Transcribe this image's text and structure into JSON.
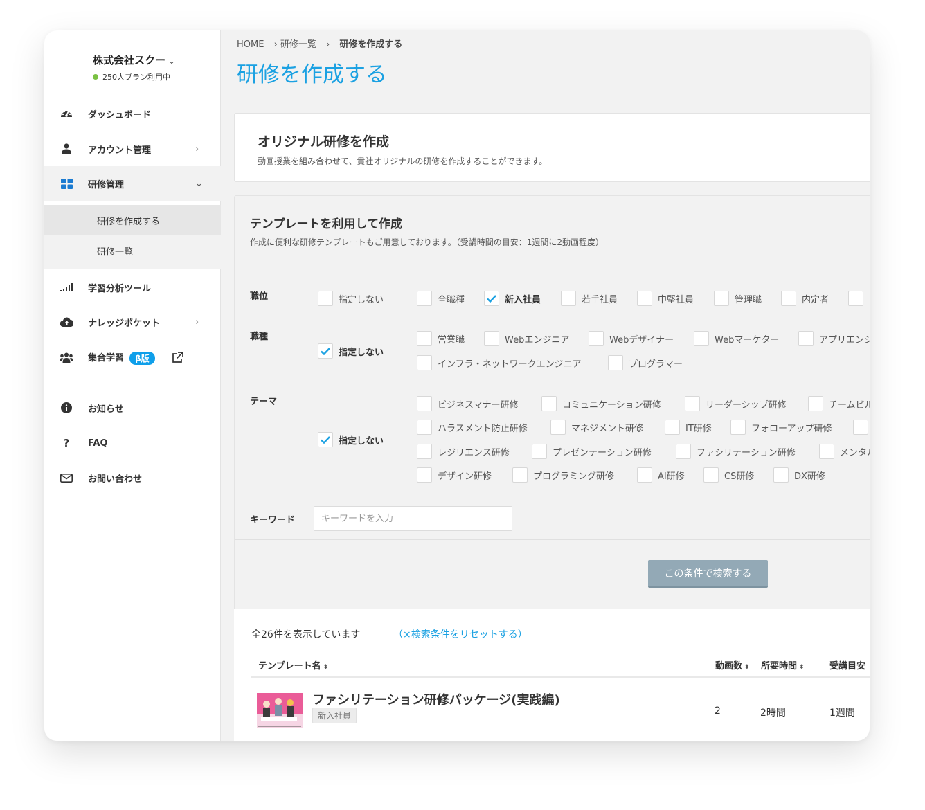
{
  "sidebar": {
    "company_name": "株式会社スクー",
    "company_chevron": "⌄",
    "plan": "250人プラン利用中",
    "items": [
      {
        "label": "ダッシュボード"
      },
      {
        "label": "アカウント管理",
        "arrow": "›"
      },
      {
        "label": "研修管理",
        "arrow": "⌄"
      },
      {
        "label": "学習分析ツール"
      },
      {
        "label": "ナレッジポケット",
        "arrow": "›"
      },
      {
        "label": "集合学習",
        "badge": "β版"
      },
      {
        "label": "お知らせ"
      },
      {
        "label": "FAQ",
        "icon_glyph": "?"
      },
      {
        "label": "お問い合わせ"
      }
    ],
    "subitems": [
      {
        "label": "研修を作成する"
      },
      {
        "label": "研修一覧"
      }
    ]
  },
  "breadcrumb": {
    "home": "HOME",
    "sep1": "› 研修一覧",
    "sep2": "›",
    "current": "研修を作成する"
  },
  "page_title": "研修を作成する",
  "original": {
    "title": "オリジナル研修を作成",
    "desc": "動画授業を組み合わせて、貴社オリジナルの研修を作成することができます。"
  },
  "template": {
    "title": "テンプレートを利用して作成",
    "desc": "作成に便利な研修テンプレートもご用意しております。（受講時間の目安：1週間に2動画程度）"
  },
  "filters": {
    "position": {
      "label": "職位",
      "none": {
        "label": "指定しない",
        "checked": false
      },
      "options": [
        {
          "label": "全職種",
          "checked": false
        },
        {
          "label": "新入社員",
          "checked": true
        },
        {
          "label": "若手社員",
          "checked": false
        },
        {
          "label": "中堅社員",
          "checked": false
        },
        {
          "label": "管理職",
          "checked": false
        },
        {
          "label": "内定者",
          "checked": false
        },
        {
          "label": "",
          "checked": false
        }
      ]
    },
    "job": {
      "label": "職種",
      "none": {
        "label": "指定しない",
        "checked": true
      },
      "options": [
        {
          "label": "営業職",
          "checked": false
        },
        {
          "label": "Webエンジニア",
          "checked": false
        },
        {
          "label": "Webデザイナー",
          "checked": false
        },
        {
          "label": "Webマーケター",
          "checked": false
        },
        {
          "label": "アプリエンジ",
          "checked": false
        },
        {
          "label": "インフラ・ネットワークエンジニア",
          "checked": false
        },
        {
          "label": "プログラマー",
          "checked": false
        }
      ]
    },
    "theme": {
      "label": "テーマ",
      "none": {
        "label": "指定しない",
        "checked": true
      },
      "options": [
        {
          "label": "ビジネスマナー研修",
          "checked": false
        },
        {
          "label": "コミュニケーション研修",
          "checked": false
        },
        {
          "label": "リーダーシップ研修",
          "checked": false
        },
        {
          "label": "チームビル",
          "checked": false
        },
        {
          "label": "ハラスメント防止研修",
          "checked": false
        },
        {
          "label": "マネジメント研修",
          "checked": false
        },
        {
          "label": "IT研修",
          "checked": false
        },
        {
          "label": "フォローアップ研修",
          "checked": false
        },
        {
          "label": "",
          "checked": false
        },
        {
          "label": "レジリエンス研修",
          "checked": false
        },
        {
          "label": "プレゼンテーション研修",
          "checked": false
        },
        {
          "label": "ファシリテーション研修",
          "checked": false
        },
        {
          "label": "メンタル",
          "checked": false
        },
        {
          "label": "デザイン研修",
          "checked": false
        },
        {
          "label": "プログラミング研修",
          "checked": false
        },
        {
          "label": "AI研修",
          "checked": false
        },
        {
          "label": "CS研修",
          "checked": false
        },
        {
          "label": "DX研修",
          "checked": false
        }
      ]
    },
    "keyword": {
      "label": "キーワード",
      "placeholder": "キーワードを入力",
      "value": ""
    }
  },
  "search_button": "この条件で検索する",
  "results": {
    "count_text": "全26件を表示しています",
    "reset_text": "（×検索条件をリセットする）",
    "columns": {
      "name": "テンプレート名",
      "videos": "動画数",
      "duration": "所要時間",
      "period": "受講目安",
      "sort_glyph": "⬍"
    },
    "rows": [
      {
        "title": "ファシリテーション研修パッケージ(実践編)",
        "tag": "新入社員",
        "videos": "2",
        "duration": "2時間",
        "period": "1週間"
      }
    ]
  },
  "colors": {
    "accent": "#1ba1e2",
    "badge": "#0f9fea",
    "button": "#93a9b6",
    "plan_dot": "#7ac143",
    "thumb": "#ea5c98"
  }
}
